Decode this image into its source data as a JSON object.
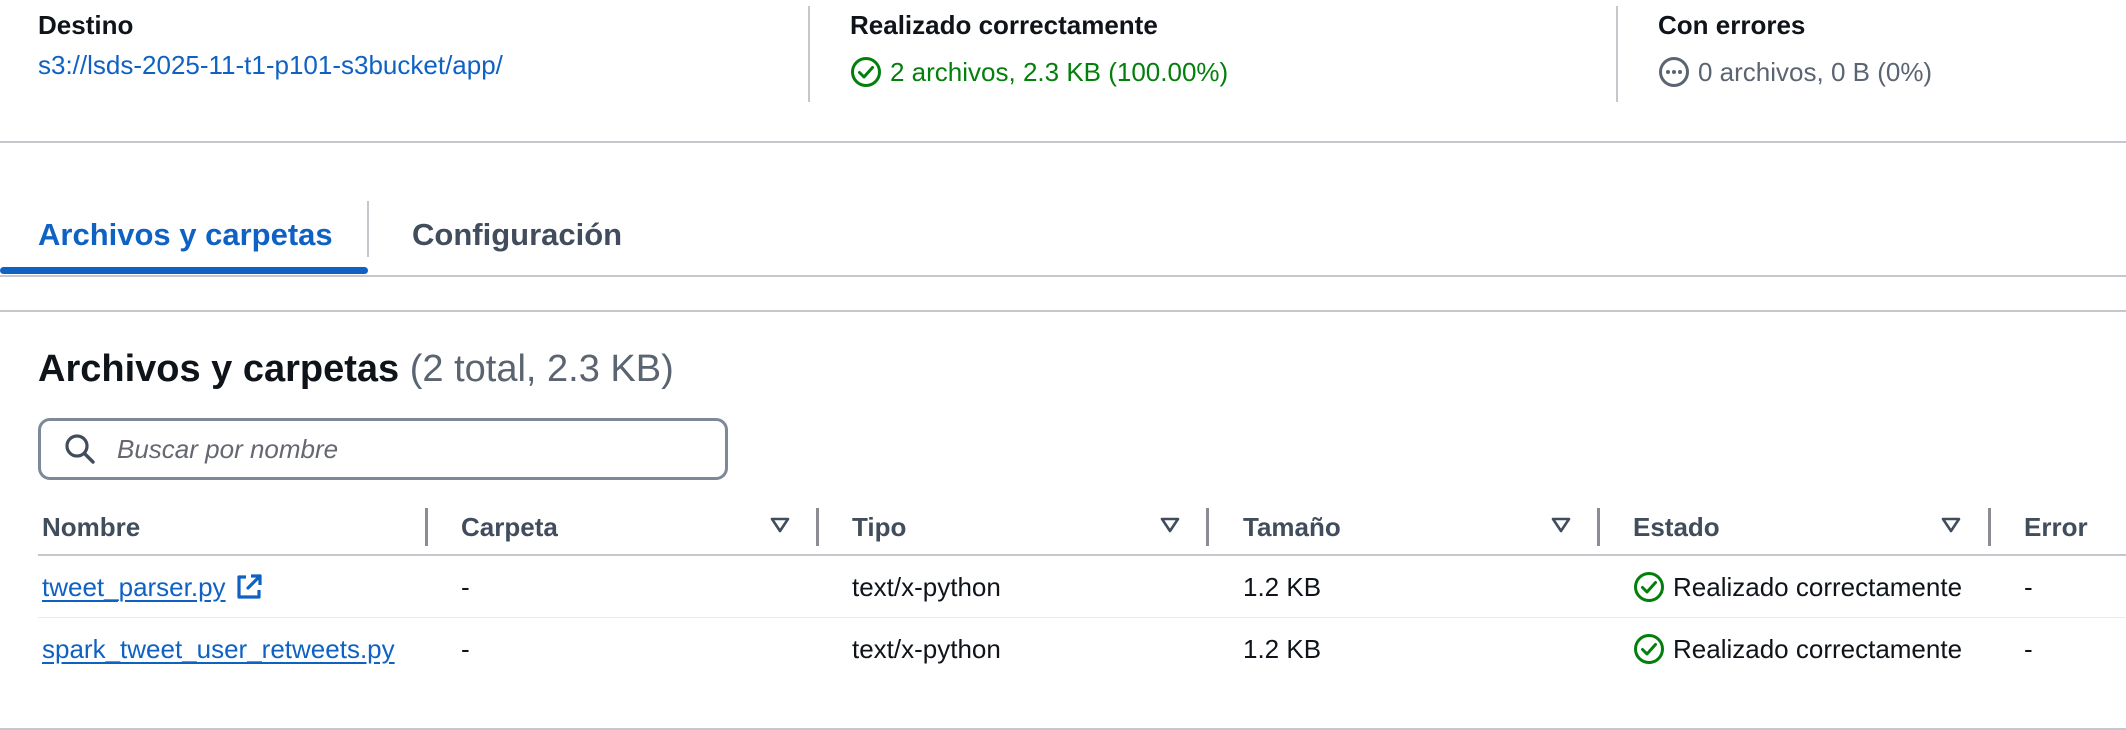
{
  "summary": {
    "destination": {
      "label": "Destino",
      "value": "s3://lsds-2025-11-t1-p101-s3bucket/app/"
    },
    "succeeded": {
      "label": "Realizado correctamente",
      "value": "2 archivos, 2.3 KB (100.00%)",
      "icon": "success-check-icon",
      "color": "#037f0c"
    },
    "failed": {
      "label": "Con errores",
      "value": "0 archivos, 0 B (0%)",
      "icon": "pending-dots-icon",
      "color": "#5b6471"
    }
  },
  "tabs": [
    {
      "label": "Archivos y carpetas",
      "active": true
    },
    {
      "label": "Configuración",
      "active": false
    }
  ],
  "files_panel": {
    "title": "Archivos y carpetas",
    "count": "(2 total, 2.3 KB)",
    "search": {
      "placeholder": "Buscar por nombre",
      "value": ""
    },
    "columns": [
      {
        "label": "Nombre",
        "sortable": false
      },
      {
        "label": "Carpeta",
        "sortable": true
      },
      {
        "label": "Tipo",
        "sortable": true
      },
      {
        "label": "Tamaño",
        "sortable": true
      },
      {
        "label": "Estado",
        "sortable": true
      },
      {
        "label": "Error",
        "sortable": false
      }
    ],
    "rows": [
      {
        "name": "tweet_parser.py",
        "external_link_icon": "external-link-icon",
        "folder": "-",
        "type": "text/x-python",
        "size": "1.2 KB",
        "status": "Realizado correctamente",
        "error": "-"
      },
      {
        "name": "spark_tweet_user_retweets.py",
        "folder": "-",
        "type": "text/x-python",
        "size": "1.2 KB",
        "status": "Realizado correctamente",
        "error": "-"
      }
    ]
  },
  "colors": {
    "link": "#0f62c4",
    "success": "#037f0c",
    "border": "#c6c6cd",
    "text": "#0f141a"
  }
}
